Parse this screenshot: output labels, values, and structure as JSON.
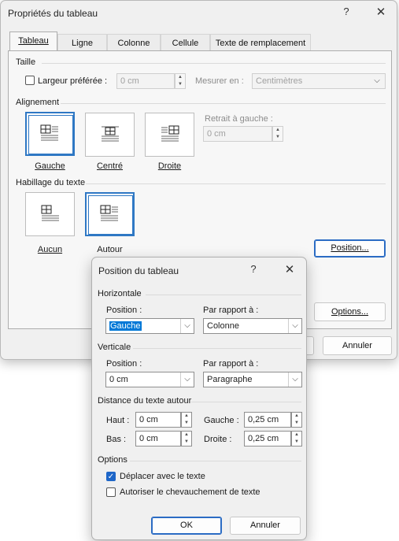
{
  "main": {
    "title": "Propriétés du tableau",
    "help": "?",
    "close": "✕",
    "tabs": [
      {
        "label": "Tableau",
        "ul_prefix": "",
        "ul": "T",
        "rest": "ableau"
      },
      {
        "label": "Ligne"
      },
      {
        "label": "Colonne"
      },
      {
        "label": "Cellule"
      },
      {
        "label": "Texte de remplacement"
      }
    ],
    "size": {
      "group": "Taille",
      "preferred_width_label": "Largeur préférée :",
      "preferred_width_value": "0 cm",
      "measure_label": "Mesurer en :",
      "measure_value": "Centimètres"
    },
    "alignment": {
      "group": "Alignement",
      "options": [
        "Gauche",
        "Centré",
        "Droite"
      ],
      "indent_label": "Retrait à gauche :",
      "indent_value": "0 cm"
    },
    "wrapping": {
      "group": "Habillage du texte",
      "options": [
        "Aucun",
        "Autour"
      ],
      "position_button": "Position...",
      "options_button": "Options..."
    },
    "cancel_button": "Annuler"
  },
  "sub": {
    "title": "Position du tableau",
    "help": "?",
    "close": "✕",
    "horizontal": {
      "group": "Horizontale",
      "position_label": "Position :",
      "position_value": "Gauche",
      "relative_label": "Par rapport à :",
      "relative_value": "Colonne"
    },
    "vertical": {
      "group": "Verticale",
      "position_label": "Position :",
      "position_value": "0 cm",
      "relative_label": "Par rapport à :",
      "relative_value": "Paragraphe"
    },
    "distance": {
      "group": "Distance du texte autour",
      "top_label": "Haut :",
      "top_value": "0 cm",
      "bottom_label": "Bas :",
      "bottom_value": "0 cm",
      "left_label": "Gauche :",
      "left_value": "0,25 cm",
      "right_label": "Droite :",
      "right_value": "0,25 cm"
    },
    "options": {
      "group": "Options",
      "move_with_text": "Déplacer avec le texte",
      "allow_overlap": "Autoriser le chevauchement de texte"
    },
    "ok": "OK",
    "cancel": "Annuler"
  }
}
